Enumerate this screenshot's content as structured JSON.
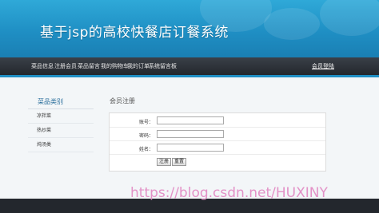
{
  "header": {
    "title": "基于jsp的高校快餐店订餐系统"
  },
  "nav": {
    "items": [
      "菜品信息",
      "注册会员",
      "菜品留言",
      "我的购物车",
      "我的订单",
      "系统留言板"
    ],
    "login": "会员登陆"
  },
  "sidebar": {
    "title": "菜品类别",
    "items": [
      "凉拌菜",
      "热炒菜",
      "炖汤类"
    ]
  },
  "main": {
    "title": "会员注册",
    "fields": [
      {
        "label": "账号：",
        "value": ""
      },
      {
        "label": "密码：",
        "value": ""
      },
      {
        "label": "姓名：",
        "value": ""
      }
    ],
    "submit": "注册",
    "reset": "重置"
  },
  "watermark": "https://blog.csdn.net/HUXINY",
  "colors": {
    "header": "#1f8fc4",
    "nav": "#2b3037",
    "footer": "#23272d"
  }
}
